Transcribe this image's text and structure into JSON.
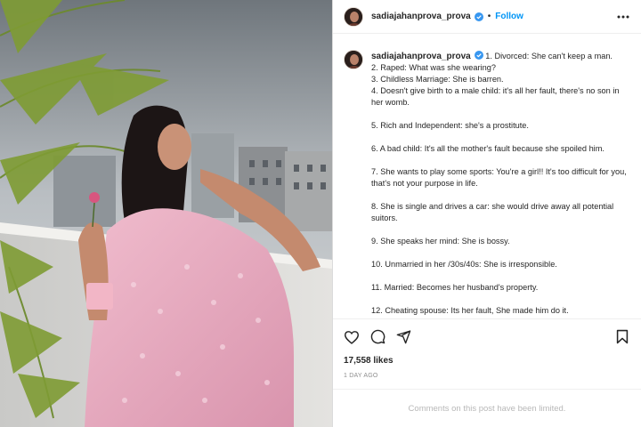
{
  "post": {
    "username": "sadiajahanprova_prova",
    "follow_label": "Follow",
    "separator": "•",
    "caption_lines": [
      "1. Divorced: She can't keep a man.",
      "2. Raped: What was she wearing?",
      "3. Childless Marriage: She is barren.",
      "4. Doesn't give birth to a male child: it's all her fault, there's no son in her womb.",
      "5. Rich and Independent: she's a prostitute.",
      "6. A bad child: It's all the mother's fault because she spoiled him.",
      "7. She wants to play some sports: You're a girl!! It's too difficult for you, that's not your purpose in life.",
      "8. She is single and drives a car: she would drive away all potential suitors.",
      "9. She speaks her mind: She is bossy.",
      "10. Unmarried in her /30s/40s: She is irresponsible.",
      "11. Married: Becomes her husband's property.",
      "12. Cheating spouse: Its her fault, She made him do it."
    ],
    "likes": "17,558 likes",
    "time_ago": "1 DAY AGO",
    "comments_limited": "Comments on this post have been limited."
  },
  "icons": {
    "more": "more-options-icon",
    "like": "heart-icon",
    "comment": "comment-icon",
    "share": "share-icon",
    "save": "bookmark-icon",
    "verified": "verified-badge-icon"
  },
  "colors": {
    "accent": "#0095f6",
    "verified": "#3897f0",
    "muted": "#8e8e8e",
    "saree": "#e6a8be"
  }
}
